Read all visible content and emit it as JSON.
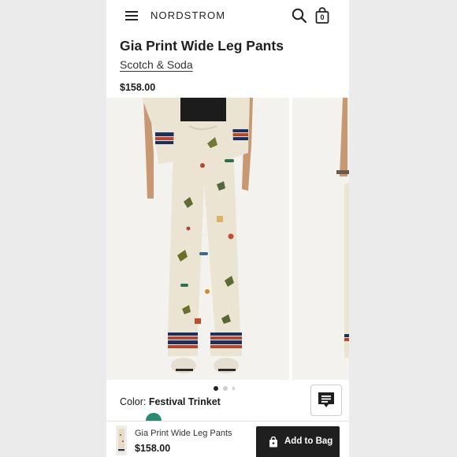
{
  "header": {
    "logo": "NORDSTROM",
    "bag_count": "0",
    "icons": [
      "menu-icon",
      "search-icon",
      "shopping-bag-icon"
    ]
  },
  "product": {
    "title": "Gia Print Wide Leg Pants",
    "brand": "Scotch & Soda",
    "price": "$158.00"
  },
  "gallery": {
    "dots_total": 3,
    "active_index": 0
  },
  "color": {
    "label": "Color:",
    "value": "Festival Trinket",
    "swatch_color": "#2b8a72"
  },
  "bottom_bar": {
    "name": "Gia Print Wide Leg Pants",
    "price": "$158.00",
    "add_button": "Add to Bag"
  },
  "colors": {
    "accent": "#1f1f1f",
    "background": "#ffffff",
    "print_base": "#ece4d3",
    "stripe_navy": "#1d2f5b",
    "stripe_red": "#b6452f"
  }
}
